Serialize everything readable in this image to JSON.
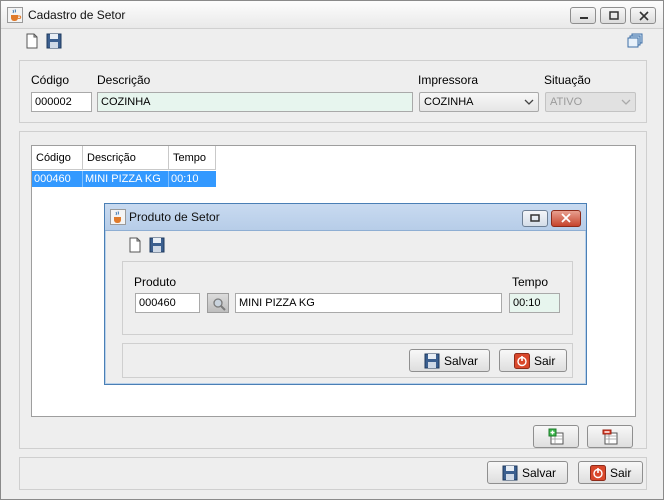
{
  "window": {
    "title": "Cadastro de Setor",
    "icon": "java-cup-icon"
  },
  "toolbar": {
    "new_icon": "new-document-icon",
    "save_icon": "floppy-disk-icon",
    "cascade_icon": "cascade-windows-icon"
  },
  "form": {
    "codigo_label": "Código",
    "codigo_value": "000002",
    "descricao_label": "Descrição",
    "descricao_value": "COZINHA",
    "impressora_label": "Impressora",
    "impressora_value": "COZINHA",
    "situacao_label": "Situação",
    "situacao_value": "ATIVO"
  },
  "table": {
    "columns": [
      "Código",
      "Descrição",
      "Tempo"
    ],
    "rows": [
      [
        "000460",
        "MINI PIZZA KG",
        "00:10"
      ]
    ]
  },
  "table_buttons": {
    "add_icon": "add-row-icon",
    "remove_icon": "remove-row-icon"
  },
  "footer": {
    "save_label": "Salvar",
    "exit_label": "Sair"
  },
  "dialog": {
    "title": "Produto de Setor",
    "produto_label": "Produto",
    "produto_code": "000460",
    "produto_name": "MINI PIZZA KG",
    "tempo_label": "Tempo",
    "tempo_value": "00:10",
    "save_label": "Salvar",
    "exit_label": "Sair"
  },
  "colors": {
    "selection": "#3399ff",
    "highlight_field": "#e7f5ee",
    "exit_red": "#d9482b"
  }
}
